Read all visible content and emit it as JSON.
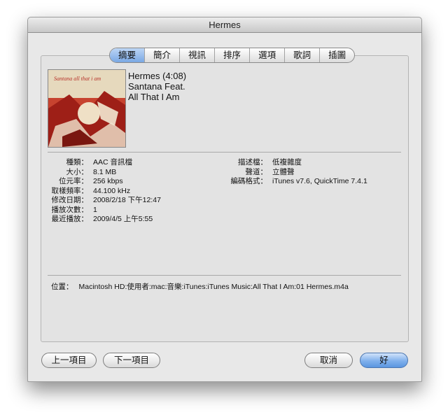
{
  "window": {
    "title": "Hermes"
  },
  "tabs": [
    "摘要",
    "簡介",
    "視訊",
    "排序",
    "選項",
    "歌詞",
    "插圖"
  ],
  "summary": {
    "headline": [
      "Hermes (4:08)",
      "Santana Feat.",
      "All That I Am"
    ],
    "artwork_text": "Santana all that i am",
    "left_fields": [
      {
        "label": "種類：",
        "value": "AAC 音訊檔"
      },
      {
        "label": "大小：",
        "value": "8.1 MB"
      },
      {
        "label": "位元率：",
        "value": "256 kbps"
      },
      {
        "label": "取樣頻率：",
        "value": "44.100 kHz"
      },
      {
        "label": "修改日期：",
        "value": "2008/2/18 下午12:47"
      },
      {
        "label": "播放次數：",
        "value": "1"
      },
      {
        "label": "最近播放：",
        "value": "2009/4/5 上午5:55"
      }
    ],
    "right_fields": [
      {
        "label": "描述檔：",
        "value": "低複雜度"
      },
      {
        "label": "聲道：",
        "value": "立體聲"
      },
      {
        "label": "編碼格式：",
        "value": "iTunes v7.6, QuickTime 7.4.1"
      }
    ],
    "location": {
      "label": "位置：",
      "value": "Macintosh HD:使用者:mac:音樂:iTunes:iTunes Music:All That I Am:01 Hermes.m4a"
    }
  },
  "buttons": {
    "previous": "上一項目",
    "next": "下一項目",
    "cancel": "取消",
    "ok": "好"
  }
}
